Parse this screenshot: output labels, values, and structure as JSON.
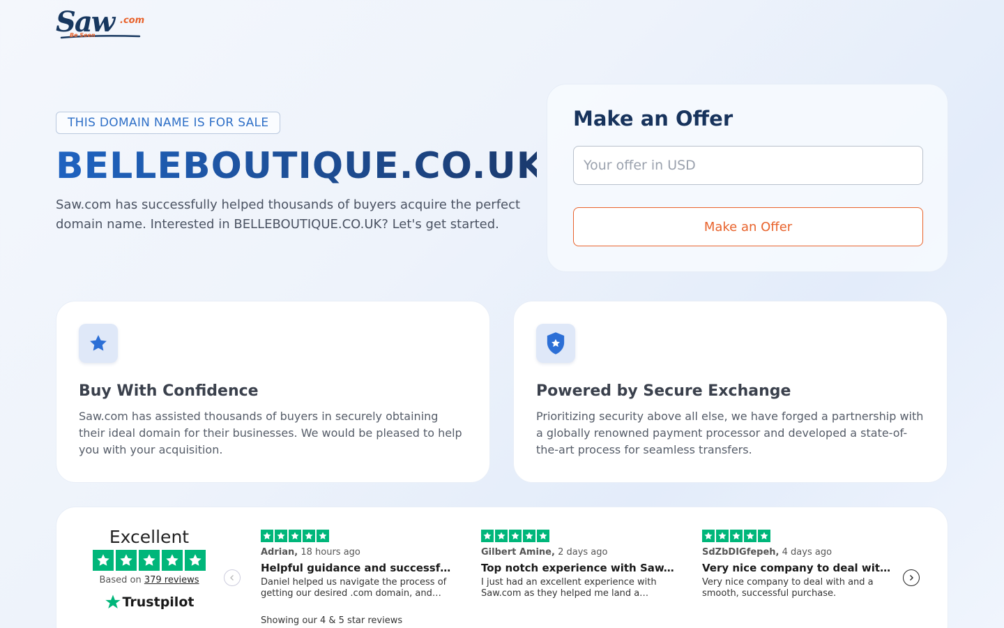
{
  "logo": {
    "name": "Saw",
    "tld": ".com",
    "tagline": "Be Seen"
  },
  "hero": {
    "badge": "THIS DOMAIN NAME IS FOR SALE",
    "domain": "BELLEBOUTIQUE.CO.UK",
    "description": "Saw.com has successfully helped thousands of buyers acquire the perfect domain name. Interested in BELLEBOUTIQUE.CO.UK? Let's get started."
  },
  "offer": {
    "title": "Make an Offer",
    "input_placeholder": "Your offer in USD",
    "input_value": "",
    "button_label": "Make an Offer"
  },
  "features": [
    {
      "icon": "star-icon",
      "title": "Buy With Confidence",
      "description": "Saw.com has assisted thousands of buyers in securely obtaining their ideal domain for their businesses. We would be pleased to help you with your acquisition."
    },
    {
      "icon": "shield-icon",
      "title": "Powered by Secure Exchange",
      "description": "Prioritizing security above all else, we have forged a partnership with a globally renowned payment processor and developed a state-of-the-art process for seamless transfers."
    }
  ],
  "trustpilot": {
    "rating_word": "Excellent",
    "based_on": "Based on",
    "reviews_link": "379 reviews",
    "logo_text": "Trustpilot",
    "stars": 5,
    "showing": "Showing our 4 & 5 star reviews",
    "reviews": [
      {
        "author": "Adrian,",
        "time": "18 hours ago",
        "title": "Helpful guidance and successful domain purchase",
        "body": "Daniel helped us navigate the process of getting our desired .com domain, and…"
      },
      {
        "author": "Gilbert Amine,",
        "time": "2 days ago",
        "title": "Top notch experience with Saw.com",
        "body": "I just had an excellent experience with Saw.com as they helped me land a…"
      },
      {
        "author": "SdZbDIGfepeh,",
        "time": "4 days ago",
        "title": "Very nice company to deal with and a smooth purchase",
        "body": "Very nice company to deal with and a smooth, successful purchase."
      }
    ]
  },
  "colors": {
    "brand_blue": "#1f5fb8",
    "accent_orange": "#e8622b",
    "trustpilot_green": "#00b67a"
  }
}
